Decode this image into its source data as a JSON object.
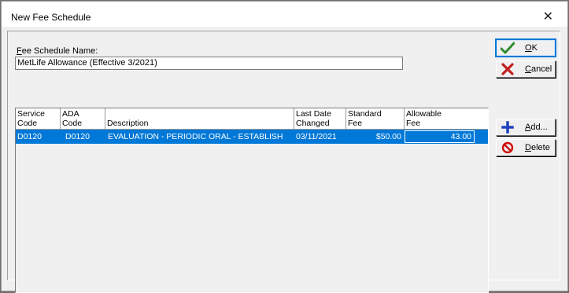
{
  "window": {
    "title": "New Fee Schedule"
  },
  "form": {
    "fee_schedule_name_label_mnemonic": "F",
    "fee_schedule_name_label_rest": "ee Schedule Name:",
    "fee_schedule_name_value": "MetLife Allowance (Effective 3/2021)"
  },
  "grid": {
    "headers": [
      {
        "line1": "Service",
        "line2": "Code"
      },
      {
        "line1": "ADA",
        "line2": "Code"
      },
      {
        "line1": "",
        "line2": "Description"
      },
      {
        "line1": "Last Date",
        "line2": "Changed"
      },
      {
        "line1": "Standard",
        "line2": "Fee"
      },
      {
        "line1": "Allowable",
        "line2": "Fee"
      }
    ],
    "rows": [
      {
        "service_code": "D0120",
        "ada_code": "D0120",
        "description": "EVALUATION - PERIODIC ORAL - ESTABLISH",
        "last_date_changed": "03/11/2021",
        "standard_fee": "$50.00",
        "allowable_fee": "43.00"
      }
    ]
  },
  "buttons": {
    "ok": {
      "mnemonic": "O",
      "rest": "K",
      "icon": "checkmark-icon"
    },
    "cancel": {
      "mnemonic": "C",
      "rest": "ancel",
      "icon": "red-x-icon"
    },
    "add": {
      "mnemonic": "A",
      "rest": "dd...",
      "icon": "blue-plus-icon"
    },
    "delete": {
      "mnemonic": "D",
      "rest": "elete",
      "icon": "no-symbol-icon"
    }
  },
  "colors": {
    "selection": "#0078d7",
    "ok_check": "#2e8b2e",
    "cancel_x": "#c0201e",
    "add_plus": "#1f3fbf",
    "delete_sign": "#d01010"
  }
}
